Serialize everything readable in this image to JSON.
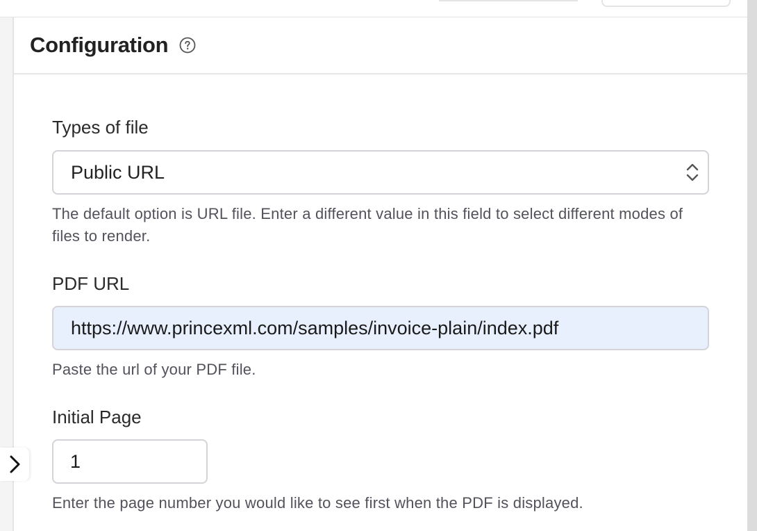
{
  "panel": {
    "title": "Configuration",
    "help_icon": "question-circle-icon"
  },
  "toggle_icon": "chevron-right-icon",
  "fields": {
    "file_type": {
      "label": "Types of file",
      "selected": "Public URL",
      "help": "The default option is URL file. Enter a different value in this field to select different modes of files to render."
    },
    "pdf_url": {
      "label": "PDF URL",
      "value": "https://www.princexml.com/samples/invoice-plain/index.pdf",
      "help": "Paste the url of your PDF file."
    },
    "initial_page": {
      "label": "Initial Page",
      "value": "1",
      "help": "Enter the page number you would like to see first when the PDF is displayed."
    }
  },
  "colors": {
    "autofill_background": "#e8f0fe",
    "border": "#d4d4d8",
    "help_text": "#52525b"
  }
}
